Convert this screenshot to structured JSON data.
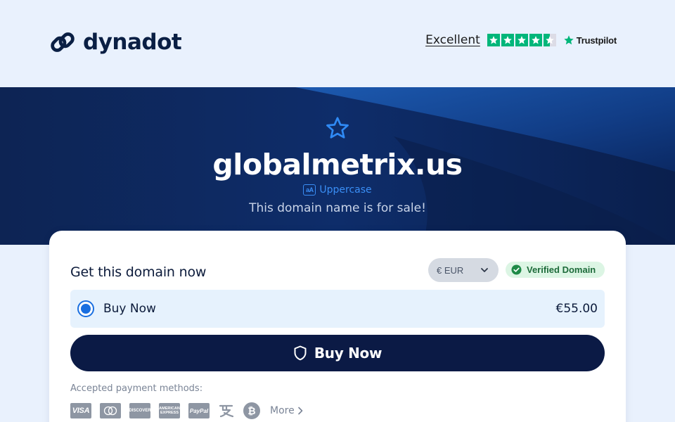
{
  "header": {
    "brand": "dynadot",
    "trustpilot": {
      "rating_label": "Excellent",
      "brand": "Trustpilot",
      "stars": 4.5,
      "star_color": "#00b67a"
    }
  },
  "hero": {
    "domain": "globalmetrix.us",
    "uppercase_icon": "aA",
    "uppercase_label": "Uppercase",
    "subtitle": "This domain name is for sale!",
    "background_color": "#0b2d6b"
  },
  "card": {
    "title": "Get this domain now",
    "currency": {
      "selected": "€ EUR"
    },
    "verified_label": "Verified Domain",
    "option": {
      "label": "Buy Now",
      "price": "€55.00",
      "selected": true
    },
    "buy_button_label": "Buy Now",
    "payments_label": "Accepted payment methods:",
    "payment_methods": [
      "VISA",
      "mastercard",
      "DISCOVER",
      "AMERICAN EXPRESS",
      "PayPal",
      "alipay",
      "bitcoin"
    ],
    "payment_text": {
      "visa": "VISA",
      "discover": "DISCOVER",
      "amex": "AMERICAN EXPRESS",
      "paypal": "PayPal",
      "bitcoin": "₿"
    },
    "more_label": "More"
  },
  "colors": {
    "accent": "#1a6fe0",
    "button": "#0b1a45",
    "verified_bg": "#dcf5e4",
    "verified_text": "#1d6b3a"
  }
}
